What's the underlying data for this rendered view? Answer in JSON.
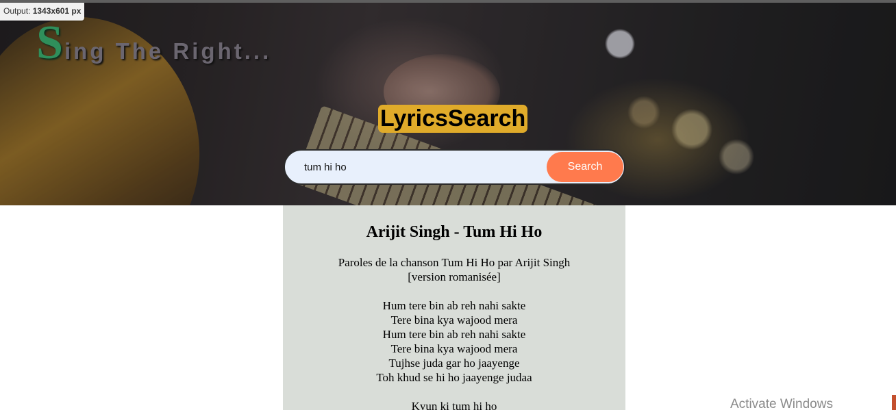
{
  "overlay": {
    "prefix": "Output: ",
    "value": "1343x601 px"
  },
  "brand": {
    "first_letter": "S",
    "rest": "ing The Right..."
  },
  "search": {
    "title": "LyricsSearch",
    "query": "tum hi ho",
    "button_label": "Search"
  },
  "result": {
    "title": "Arijit Singh - Tum Hi Ho",
    "stanzas": [
      [
        "Paroles de la chanson Tum Hi Ho par Arijit Singh",
        "[version romanisée]"
      ],
      [
        "Hum tere bin ab reh nahi sakte",
        "Tere bina kya wajood mera",
        "Hum tere bin ab reh nahi sakte",
        "Tere bina kya wajood mera",
        "Tujhse juda gar ho jaayenge",
        "Toh khud se hi ho jaayenge judaa"
      ],
      [
        "Kyun ki tum hi ho"
      ]
    ]
  },
  "watermark": {
    "text": "Activate Windows"
  },
  "colors": {
    "brand_letter": "#2f8f5b",
    "title_badge": "#e0ab2a",
    "search_button": "#ff7a4d",
    "search_bar": "#e8f0fc",
    "lyrics_panel": "#d9ddd8"
  }
}
